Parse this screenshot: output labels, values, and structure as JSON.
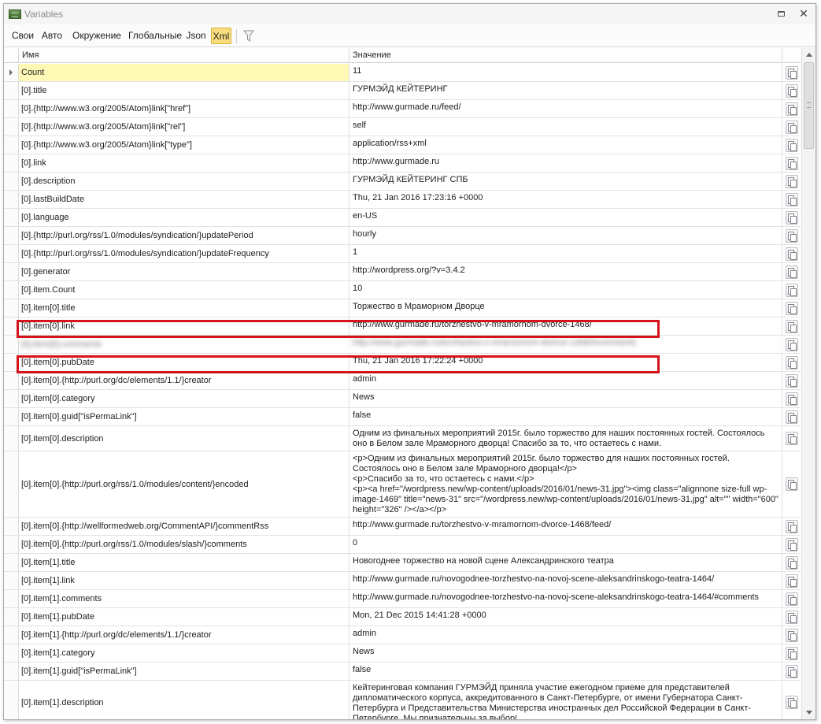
{
  "window": {
    "title": "Variables",
    "app_icon": "variables-app-icon",
    "restore_icon": "restore-icon",
    "close_icon": "close-icon",
    "close_label": "✕"
  },
  "toolbar": {
    "tabs": [
      "Свои",
      "Авто",
      "Окружение",
      "Глобальные",
      "Json",
      "Xml"
    ],
    "active_tab": "Xml",
    "active_color": "#f9dc7e",
    "filter_icon": "filter-icon"
  },
  "grid": {
    "headers": {
      "name": "Имя",
      "value": "Значение"
    },
    "selected_color": "#fff9b5",
    "highlight_color": "#d3141b",
    "copy_icon": "copy-icon",
    "rows": [
      {
        "name": "Count",
        "value": "11"
      },
      {
        "name": "[0].title",
        "value": "ГУРМЭЙД КЕЙТЕРИНГ"
      },
      {
        "name": "[0].{http://www.w3.org/2005/Atom}link[\"href\"]",
        "value": "http://www.gurmade.ru/feed/"
      },
      {
        "name": "[0].{http://www.w3.org/2005/Atom}link[\"rel\"]",
        "value": "self"
      },
      {
        "name": "[0].{http://www.w3.org/2005/Atom}link[\"type\"]",
        "value": "application/rss+xml"
      },
      {
        "name": "[0].link",
        "value": "http://www.gurmade.ru"
      },
      {
        "name": "[0].description",
        "value": "ГУРМЭЙД КЕЙТЕРИНГ СПБ"
      },
      {
        "name": "[0].lastBuildDate",
        "value": "Thu, 21 Jan 2016 17:23:16 +0000"
      },
      {
        "name": "[0].language",
        "value": "en-US"
      },
      {
        "name": "[0].{http://purl.org/rss/1.0/modules/syndication/}updatePeriod",
        "value": "hourly"
      },
      {
        "name": "[0].{http://purl.org/rss/1.0/modules/syndication/}updateFrequency",
        "value": "1"
      },
      {
        "name": "[0].generator",
        "value": "http://wordpress.org/?v=3.4.2"
      },
      {
        "name": "[0].item.Count",
        "value": "10"
      },
      {
        "name": "[0].item[0].title",
        "value": "Торжество в Мраморном Дворце"
      },
      {
        "name": "[0].item[0].link",
        "value": "http://www.gurmade.ru/torzhestvo-v-mramornom-dvorce-1468/"
      },
      {
        "name": "[0].item[0].comments",
        "value": "http://www.gurmade.ru/torzhestvo-v-mramornom-dvorce-1468/#comments"
      },
      {
        "name": "[0].item[0].pubDate",
        "value": "Thu, 21 Jan 2016 17:22:24 +0000"
      },
      {
        "name": "[0].item[0].{http://purl.org/dc/elements/1.1/}creator",
        "value": "admin"
      },
      {
        "name": "[0].item[0].category",
        "value": "News"
      },
      {
        "name": "[0].item[0].guid[\"isPermaLink\"]",
        "value": "false"
      },
      {
        "name": "[0].item[0].description",
        "value": "Одним из финальных мероприятий 2015г. было торжество для наших постоянных гостей. Состоялось оно в Белом зале Мраморного дворца! Спасибо за то, что остаетесь с нами."
      },
      {
        "name": "[0].item[0].{http://purl.org/rss/1.0/modules/content/}encoded",
        "value": "<p>Одним из финальных мероприятий 2015г. было торжество для наших постоянных гостей. Состоялось оно в Белом зале Мраморного дворца!</p>\n<p>Спасибо за то, что остаетесь с нами.</p>\n<p><a href=\"/wordpress.new/wp-content/uploads/2016/01/news-31.jpg\"><img class=\"alignnone size-full wp-image-1469\" title=\"news-31\" src=\"/wordpress.new/wp-content/uploads/2016/01/news-31.jpg\" alt=\"\" width=\"600\" height=\"326\" /></a></p>"
      },
      {
        "name": "[0].item[0].{http://wellformedweb.org/CommentAPI/}commentRss",
        "value": "http://www.gurmade.ru/torzhestvo-v-mramornom-dvorce-1468/feed/"
      },
      {
        "name": "[0].item[0].{http://purl.org/rss/1.0/modules/slash/}comments",
        "value": "0"
      },
      {
        "name": "[0].item[1].title",
        "value": "Новогоднее торжество на новой сцене Александринского театра"
      },
      {
        "name": "[0].item[1].link",
        "value": "http://www.gurmade.ru/novogodnee-torzhestvo-na-novoj-scene-aleksandrinskogo-teatra-1464/"
      },
      {
        "name": "[0].item[1].comments",
        "value": "http://www.gurmade.ru/novogodnee-torzhestvo-na-novoj-scene-aleksandrinskogo-teatra-1464/#comments"
      },
      {
        "name": "[0].item[1].pubDate",
        "value": "Mon, 21 Dec 2015 14:41:28 +0000"
      },
      {
        "name": "[0].item[1].{http://purl.org/dc/elements/1.1/}creator",
        "value": "admin"
      },
      {
        "name": "[0].item[1].category",
        "value": "News"
      },
      {
        "name": "[0].item[1].guid[\"isPermaLink\"]",
        "value": "false"
      },
      {
        "name": "[0].item[1].description",
        "value": "Кейтеринговая компания ГУРМЭЙД приняла участие ежегодном приеме для представителей дипломатического корпуса, аккредитованного в Санкт-Петербурге, от имени Губернатора Санкт-Петербурга и Представительства Министерства иностранных дел Российской Федерации в Санкт-Петербурге. Мы признательны за выбор!"
      }
    ]
  }
}
